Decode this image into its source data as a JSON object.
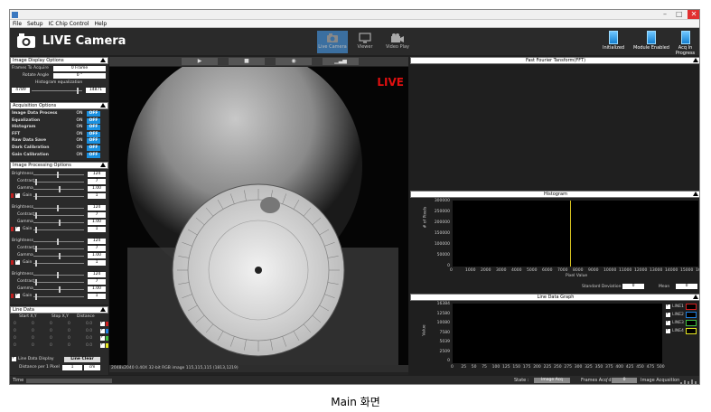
{
  "window": {
    "min": "–",
    "max": "□",
    "close": "✕"
  },
  "menu": [
    "File",
    "Setup",
    "IC Chip Control",
    "Help"
  ],
  "app_title": "LIVE Camera",
  "toolbar": [
    {
      "label": "Live Camera",
      "icon": "camera-icon"
    },
    {
      "label": "Viewer",
      "icon": "monitor-icon"
    },
    {
      "label": "Video Play",
      "icon": "film-camera-icon"
    }
  ],
  "status_indicators": [
    "Initialized",
    "Module Enabled",
    "Acq In Progress"
  ],
  "display_options": {
    "title": "Image Display Options",
    "frames_label": "Frames To Acquire",
    "frames_value": "0 Frame",
    "rotate_label": "Rotate Angle",
    "rotate_value": "0 °",
    "hist_label": "Histogram equalization",
    "hist_min": "4789",
    "hist_max": "14871"
  },
  "acq_options": {
    "title": "Acquisition Options",
    "on": "ON",
    "off": "OFF",
    "rows": [
      "Image Data Process",
      "Equalization",
      "Histogram",
      "FFT",
      "Raw Data Save",
      "Dark Calibration",
      "Gain Calibration"
    ]
  },
  "proc_options": {
    "title": "Image Processing Options",
    "groups": [
      {
        "brightness": "124",
        "contrast": "7",
        "gamma": "1.00",
        "gain": "1"
      },
      {
        "brightness": "124",
        "contrast": "7",
        "gamma": "1.00",
        "gain": "1"
      },
      {
        "brightness": "124",
        "contrast": "7",
        "gamma": "1.00",
        "gain": "1"
      },
      {
        "brightness": "124",
        "contrast": "7",
        "gamma": "1.00",
        "gain": "1"
      }
    ],
    "labels": {
      "brightness": "Brightness",
      "contrast": "Contrast",
      "gamma": "Gamma",
      "gain": "Gain"
    }
  },
  "line_data": {
    "title": "Line Data",
    "headers": [
      "Start X,Y",
      "Stop X,Y",
      "Distance"
    ],
    "rows": [
      [
        "0",
        "0",
        "0",
        "0",
        "0.0"
      ],
      [
        "0",
        "0",
        "0",
        "0",
        "0.0"
      ],
      [
        "0",
        "0",
        "0",
        "0",
        "0.0"
      ],
      [
        "0",
        "0",
        "0",
        "0",
        "0.0"
      ]
    ],
    "colors": [
      "#d02020",
      "#2080e0",
      "#40c040",
      "#e8e820"
    ],
    "display_label": "Line Data Display",
    "clear_label": "Line Clear",
    "dist_label": "Distance per 1 Pixel",
    "dist_value": "1",
    "dist_unit": "cm"
  },
  "live_badge": "LIVE",
  "image_info": "2048x2040 0.40X 32-bit RGB image 115,115,115    (1813,1219)",
  "fft": {
    "title": "Fast Fourier Tansform(FFT)"
  },
  "histogram": {
    "title": "Histogram",
    "ylabel": "# of Pixels",
    "xlabel": "Pixel Value",
    "y_ticks": [
      "300000",
      "250000",
      "200000",
      "150000",
      "100000",
      "50000",
      "0"
    ],
    "x_ticks": [
      "0",
      "1000",
      "2000",
      "3000",
      "4000",
      "5000",
      "6000",
      "7000",
      "8000",
      "9000",
      "10000",
      "11000",
      "12000",
      "13000",
      "14000",
      "15000",
      "16383"
    ],
    "std_label": "Standard Deviation",
    "std_value": "0",
    "mean_label": "Mean",
    "mean_value": "0"
  },
  "line_graph": {
    "title": "Line Data Graph",
    "ylabel": "Value",
    "y_ticks": [
      "16384",
      "12580",
      "10080",
      "7580",
      "5039",
      "2509",
      "0"
    ],
    "x_ticks": [
      "0",
      "25",
      "50",
      "75",
      "100",
      "125",
      "150",
      "175",
      "200",
      "225",
      "250",
      "275",
      "300",
      "325",
      "350",
      "375",
      "400",
      "425",
      "450",
      "475",
      "500"
    ],
    "legend": [
      "LINE1",
      "LINE2",
      "LINE3",
      "LINE4"
    ]
  },
  "statusbar": {
    "time": "Time",
    "state_label": "State :",
    "state_value": "Image Acq",
    "frames_label": "Frames Acq'd",
    "frames_value": "0",
    "acq_label": "Image Acqusition"
  },
  "caption": "Main 화면"
}
